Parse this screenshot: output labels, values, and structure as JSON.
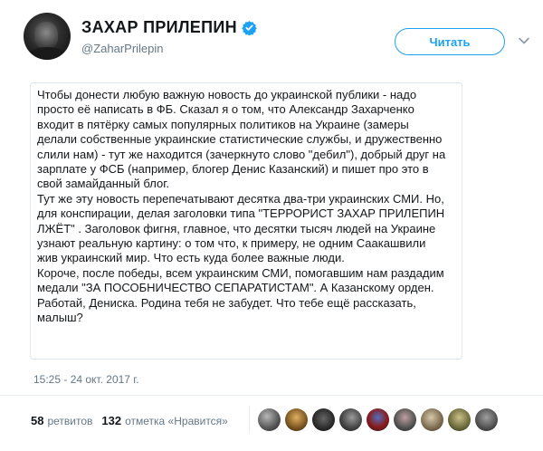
{
  "profile": {
    "display_name": "ЗАХАР ПРИЛЕПИН",
    "handle": "@ZaharPrilepin",
    "follow_label": "Читать"
  },
  "tweet": {
    "lines": [
      "Чтобы донести любую важную новость до украинской публики - надо",
      "просто её написать в ФБ. Сказал я о том, что Александр Захарченко",
      "входит в пятёрку самых популярных политиков на Украине (замеры",
      "делали собственные украинские статистические службы, и дружественно",
      "слили нам) - тут же находится (зачеркнуто слово \"дебил\"), добрый друг на",
      "зарплате у ФСБ (например, блогер Денис Казанский) и пишет про это в",
      "свой замайданный блог.",
      "Тут же эту новость перепечатывают десятка два-три украинских СМИ. Но,",
      "для конспирации, делая заголовки типа \"ТЕРРОРИСТ ЗАХАР ПРИЛЕПИН",
      "ЛЖЁТ\" . Заголовок фигня, главное, что десятки тысяч людей на Украине",
      "узнают реальную картину: о том что, к примеру, не одним Саакашвили",
      "жив украинский мир. Что есть куда более важные люди.",
      "Короче, после победы, всем украинским СМИ, помогавшим нам раздадим",
      "медали \"ЗА ПОСОБНИЧЕСТВО СЕПАРАТИСТАМ\". А Казанскому орден.",
      "Работай, Дениска. Родина тебя не забудет. Что тебе ещё рассказать,",
      "малыш?"
    ],
    "timestamp": "15:25 - 24 окт. 2017 г."
  },
  "stats": {
    "retweets_count": "58",
    "retweets_label": "ретвитов",
    "likes_count": "132",
    "likes_label": "отметка «Нравится»"
  },
  "colors": {
    "accent": "#1da1f2",
    "secondary_text": "#657786",
    "border": "#e1e8ed"
  }
}
